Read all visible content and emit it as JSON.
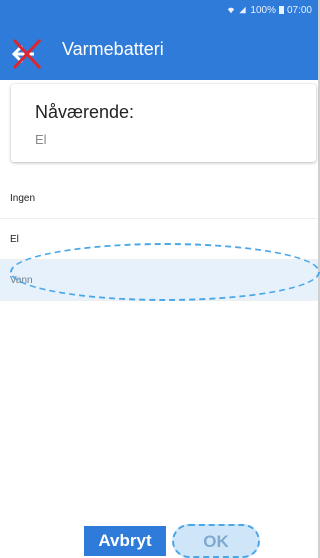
{
  "status": {
    "battery_text": "100%",
    "time": "07:00"
  },
  "header": {
    "title": "Varmebatteri",
    "back_icon": "back-arrow-icon"
  },
  "current": {
    "label": "Nåværende:",
    "value": "El"
  },
  "options": [
    {
      "label": "Ingen"
    },
    {
      "label": "El"
    },
    {
      "label": "Vann"
    }
  ],
  "selected_option": "Vann",
  "buttons": {
    "cancel_label": "Avbryt",
    "ok_label": "OK"
  },
  "colors": {
    "appbar": "#2f7bd9",
    "selected_bg": "#e6f1fb",
    "annotation_red": "#e0242b",
    "annotation_blue": "#4aa8e8"
  }
}
